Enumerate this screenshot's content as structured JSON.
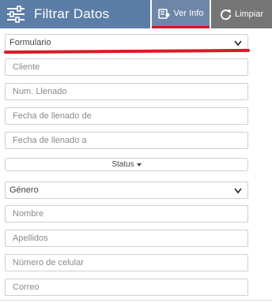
{
  "header": {
    "title": "Filtrar Datos",
    "ver_info_label": "Ver Info",
    "limpiar_label": "Limpiar"
  },
  "form": {
    "formulario_select": "Formulario",
    "cliente_placeholder": "Cliente",
    "num_llenado_placeholder": "Num. Llenado",
    "fecha_de_placeholder": "Fecha de llenado de",
    "fecha_a_placeholder": "Fecha de llenado a",
    "status_label": "Status",
    "genero_select": "Género",
    "nombre_placeholder": "Nombre",
    "apellidos_placeholder": "Apellidos",
    "celular_placeholder": "Número de celular",
    "correo_placeholder": "Correo"
  },
  "icons": {
    "filter": "sliders-icon",
    "ver_info": "id-card-icon",
    "limpiar": "refresh-icon",
    "select_arrow": "chevron-down-icon"
  },
  "colors": {
    "header_bg": "#5b7da7",
    "ver_info_bg": "#6e86a8",
    "limpiar_bg": "#757575",
    "accent_red": "#d81b26"
  }
}
